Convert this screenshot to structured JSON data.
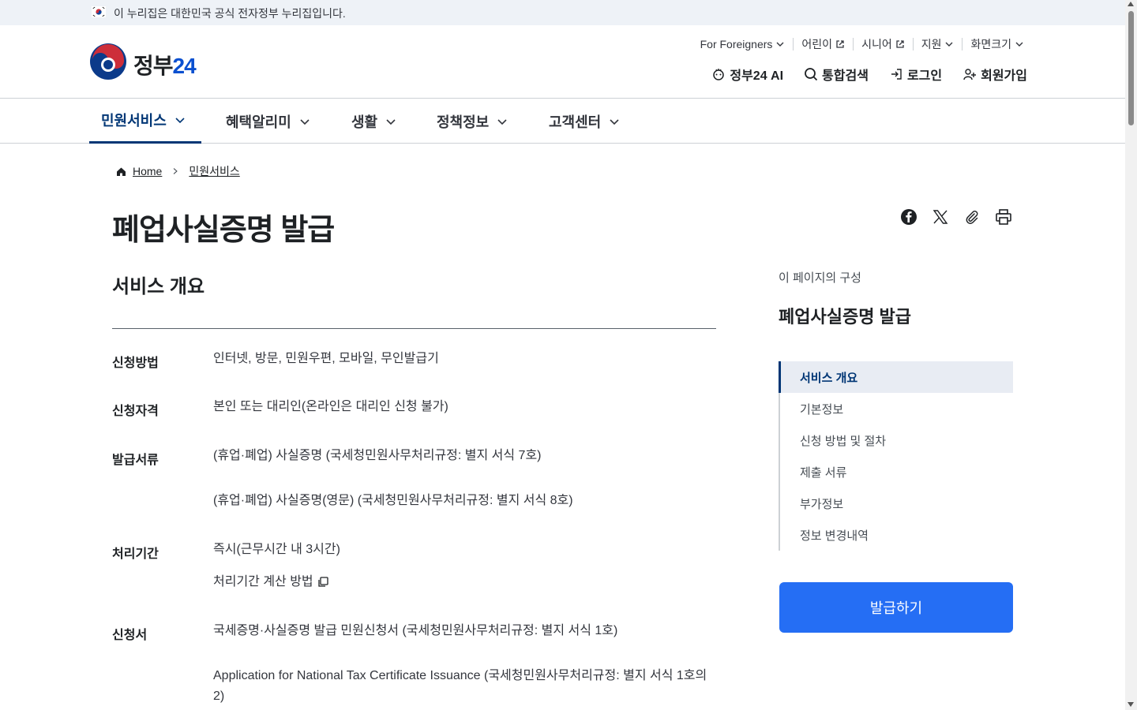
{
  "banner": {
    "text": "이 누리집은 대한민국 공식 전자정부 누리집입니다."
  },
  "logo": {
    "text": "정부",
    "number": "24"
  },
  "utility": [
    {
      "label": "For Foreigners",
      "icon": "chevron-down-icon"
    },
    {
      "label": "어린이",
      "icon": "external-link-icon"
    },
    {
      "label": "시니어",
      "icon": "external-link-icon"
    },
    {
      "label": "지원",
      "icon": "chevron-down-icon"
    },
    {
      "label": "화면크기",
      "icon": "chevron-down-icon"
    }
  ],
  "mainlinks": [
    {
      "label": "정부24 AI",
      "icon": "ai-icon"
    },
    {
      "label": "통합검색",
      "icon": "search-icon"
    },
    {
      "label": "로그인",
      "icon": "login-icon"
    },
    {
      "label": "회원가입",
      "icon": "user-add-icon"
    }
  ],
  "gnb": [
    {
      "label": "민원서비스",
      "active": true
    },
    {
      "label": "혜택알리미",
      "active": false
    },
    {
      "label": "생활",
      "active": false
    },
    {
      "label": "정책정보",
      "active": false
    },
    {
      "label": "고객센터",
      "active": false
    }
  ],
  "breadcrumb": {
    "home": "Home",
    "current": "민원서비스"
  },
  "page": {
    "title": "폐업사실증명 발급"
  },
  "share": [
    "facebook-icon",
    "x-icon",
    "link-icon",
    "print-icon"
  ],
  "overview": {
    "title": "서비스 개요",
    "rows": [
      {
        "label": "신청방법",
        "values": [
          "인터넷, 방문, 민원우편, 모바일, 무인발급기"
        ]
      },
      {
        "label": "신청자격",
        "values": [
          "본인 또는 대리인(온라인은 대리인 신청 불가)"
        ]
      },
      {
        "label": "발급서류",
        "values": [
          "(휴업·폐업) 사실증명 (국세청민원사무처리규정: 별지 서식 7호)",
          "(휴업·폐업) 사실증명(영문) (국세청민원사무처리규정: 별지 서식 8호)"
        ]
      },
      {
        "label": "처리기간",
        "values": [
          "즉시(근무시간 내 3시간)",
          "처리기간 계산 방법"
        ]
      },
      {
        "label": "신청서",
        "values": [
          "국세증명·사실증명 발급 민원신청서 (국세청민원사무처리규정: 별지 서식 1호)",
          "Application for National Tax Certificate Issuance (국세청민원사무처리규정: 별지 서식 1호의 2)"
        ]
      }
    ]
  },
  "toc": {
    "caption": "이 페이지의 구성",
    "title": "폐업사실증명 발급",
    "items": [
      "서비스 개요",
      "기본정보",
      "신청 방법 및 절차",
      "제출 서류",
      "부가정보",
      "정보 변경내역"
    ]
  },
  "cta": {
    "label": "발급하기"
  },
  "colors": {
    "primary": "#256ef4",
    "navy": "#003675"
  }
}
